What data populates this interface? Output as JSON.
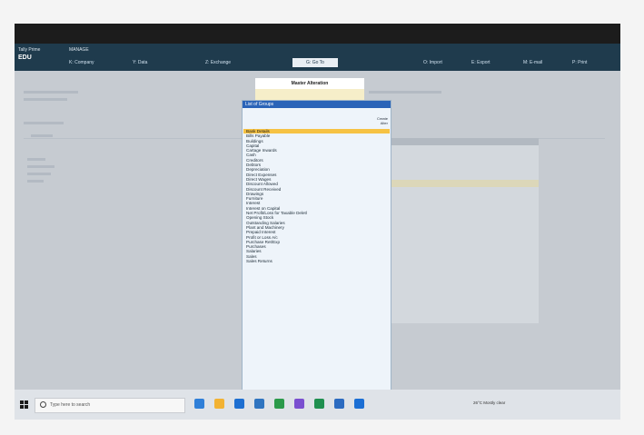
{
  "header": {
    "company_label": "Tally Prime",
    "edu_label": "EDU",
    "manage_label": "MANAGE"
  },
  "menu": {
    "company": "K: Company",
    "data": "Y: Data",
    "exchange": "Z: Exchange",
    "goto": "G: Go To",
    "import": "O: Import",
    "export": "E: Export",
    "email": "M: E-mail",
    "print": "P: Print"
  },
  "group_window": {
    "title": "Master Alteration",
    "list_header": "List of Groups",
    "create_label": "Create",
    "alter_label": "Alter",
    "items": [
      "Bank Details",
      "Bills Payable",
      "Buildings",
      "Capital",
      "Cartage Inwards",
      "Cash",
      "Creditors",
      "Debtors",
      "Depreciation",
      "Direct Expenses",
      "Direct Wages",
      "Discount Allowed",
      "Discount Received",
      "Drawings",
      "Furniture",
      "Interest",
      "Interest on Capital",
      "Net Profit/Loss for Taxable Deletl",
      "Opening Stock",
      "Outstanding Salaries",
      "Plant and Machinery",
      "Prepaid Interest",
      "Profit or Loss A/c",
      "Purchase Ret/Exp",
      "Purchases",
      "Salaries",
      "Sales",
      "Sales Returns"
    ],
    "selected_index": 0
  },
  "taskbar": {
    "search_placeholder": "Type here to search",
    "weather": "26°C  Mostly clear",
    "colors": [
      "#2f7fd8",
      "#f2b233",
      "#1e6fd1",
      "#2f74c0",
      "#2b9a4a",
      "#7a4fd0",
      "#1f8f4f",
      "#2c6bc0",
      "#1c6fd4"
    ]
  },
  "colors": {
    "header_bg": "#1f3b4d",
    "list_head_bg": "#2a64b8",
    "selected_row": "#f6c243",
    "field_bg": "#f6eec9"
  }
}
